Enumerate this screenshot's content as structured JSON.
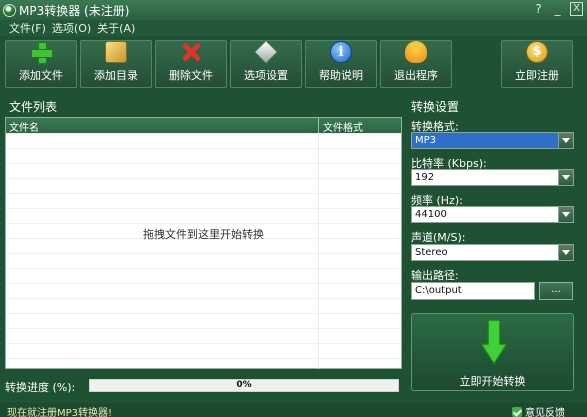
{
  "window": {
    "title": "MP3转换器 (未注册)",
    "help_glyph": "?",
    "minimize_glyph": "_",
    "close_glyph": "X"
  },
  "menu": [
    {
      "label": "文件(F)"
    },
    {
      "label": "选项(O)"
    },
    {
      "label": "关于(A)"
    }
  ],
  "toolbar": {
    "add_file": "添加文件",
    "add_dir": "添加目录",
    "delete_file": "删除文件",
    "options": "选项设置",
    "help": "帮助说明",
    "exit": "退出程序",
    "register": "立即注册"
  },
  "file_list": {
    "section_title": "文件列表",
    "col_name": "文件名",
    "col_format": "文件格式",
    "drop_hint": "拖拽文件到这里开始转换",
    "rows": []
  },
  "progress": {
    "label": "转换进度 (%):",
    "value_text": "0%",
    "value": 0
  },
  "settings": {
    "section_title": "转换设置",
    "format_label": "转换格式:",
    "format_value": "MP3",
    "bitrate_label": "比特率 (Kbps):",
    "bitrate_value": "192",
    "frequency_label": "频率 (Hz):",
    "frequency_value": "44100",
    "channel_label": "声道(M/S):",
    "channel_value": "Stereo",
    "output_label": "输出路径:",
    "output_value": "C:\\output",
    "browse_label": "...",
    "start_label": "立即开始转换"
  },
  "status": {
    "text": "现在就注册MP3转换器!",
    "feedback": "意见反馈"
  },
  "colors": {
    "background": "#1f5232",
    "accent_selection": "#2f6fc8",
    "start_arrow": "#3fd03a"
  }
}
